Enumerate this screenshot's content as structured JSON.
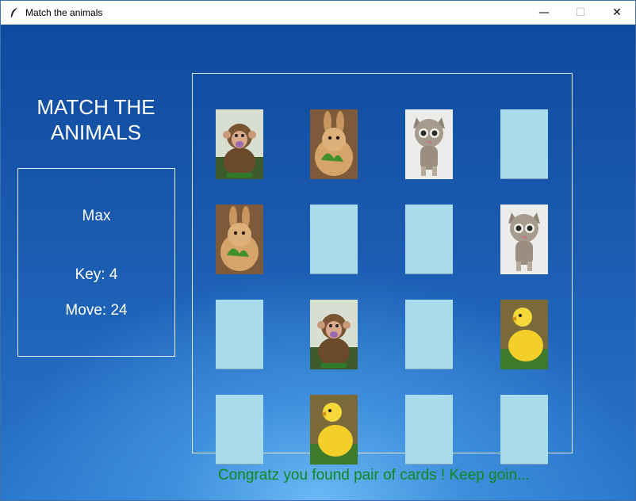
{
  "window": {
    "title": "Match the animals",
    "controls": {
      "minimize": "—",
      "maximize": "☐",
      "close": "✕"
    }
  },
  "game": {
    "heading_line1": "MATCH THE",
    "heading_line2": "ANIMALS",
    "player_name": "Max",
    "key_label": "Key: 4",
    "move_label": "Move: 24",
    "status_message": "Congratz you found pair of cards ! Keep goin..."
  },
  "board": {
    "rows": 4,
    "cols": 4,
    "cards": [
      {
        "face": "monkey"
      },
      {
        "face": "rabbit"
      },
      {
        "face": "kitten"
      },
      {
        "face": "hidden"
      },
      {
        "face": "rabbit"
      },
      {
        "face": "hidden"
      },
      {
        "face": "hidden"
      },
      {
        "face": "kitten"
      },
      {
        "face": "hidden"
      },
      {
        "face": "monkey"
      },
      {
        "face": "hidden"
      },
      {
        "face": "duckling"
      },
      {
        "face": "hidden"
      },
      {
        "face": "duckling"
      },
      {
        "face": "hidden"
      },
      {
        "face": "hidden"
      }
    ]
  },
  "colors": {
    "card_back": "#a9dcea",
    "status_text": "#0d8a1e",
    "background_top": "#0f4a9e",
    "background_glow": "#6cb8f5"
  }
}
